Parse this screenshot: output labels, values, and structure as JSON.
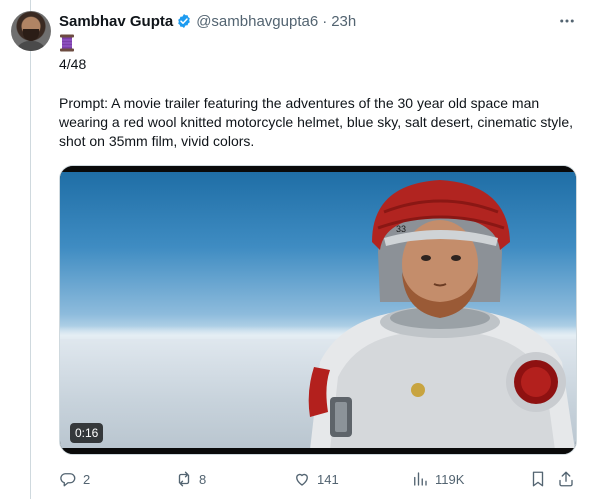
{
  "tweet": {
    "author_name": "Sambhav Gupta",
    "handle": "@sambhavgupta6",
    "separator": "·",
    "time": "23h",
    "line1": "4/48",
    "prompt_text": "Prompt: A movie trailer featuring the adventures of the 30 year old space man wearing a red wool knitted motorcycle helmet, blue sky, salt desert, cinematic style, shot on 35mm film, vivid colors."
  },
  "media": {
    "duration": "0:16"
  },
  "actions": {
    "replies": "2",
    "reposts": "8",
    "likes": "141",
    "views": "119K"
  },
  "icons": {
    "verified": "verified-badge-icon",
    "more": "more-icon",
    "spool": "thread-spool-emoji",
    "reply": "reply-icon",
    "repost": "repost-icon",
    "like": "heart-icon",
    "views": "views-chart-icon",
    "bookmark": "bookmark-icon",
    "share": "share-icon"
  },
  "colors": {
    "accent": "#1d9bf0",
    "text": "#0f1419",
    "muted": "#536471",
    "border": "#cfd9de"
  }
}
